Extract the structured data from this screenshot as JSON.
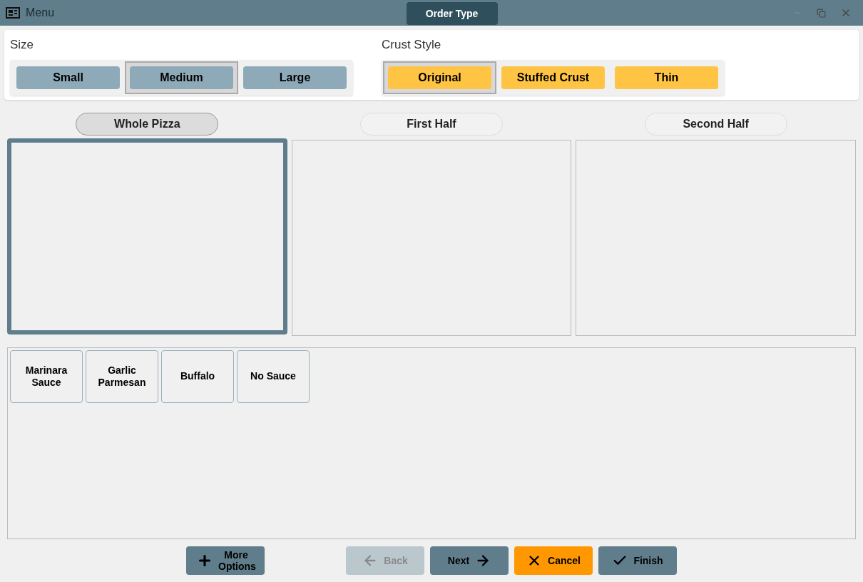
{
  "window": {
    "title": "Menu",
    "tab": "Order Type"
  },
  "size": {
    "label": "Size",
    "options": [
      {
        "label": "Small",
        "selected": false
      },
      {
        "label": "Medium",
        "selected": true
      },
      {
        "label": "Large",
        "selected": false
      }
    ]
  },
  "crust": {
    "label": "Crust Style",
    "options": [
      {
        "label": "Original",
        "selected": true
      },
      {
        "label": "Stuffed Crust",
        "selected": false
      },
      {
        "label": "Thin",
        "selected": false
      }
    ]
  },
  "portions": [
    {
      "label": "Whole Pizza",
      "selected": true
    },
    {
      "label": "First Half",
      "selected": false
    },
    {
      "label": "Second Half",
      "selected": false
    }
  ],
  "sauces": [
    "Marinara Sauce",
    "Garlic Parmesan",
    "Buffalo",
    "No Sauce"
  ],
  "footer": [
    {
      "kind": "plus",
      "label": "More Options",
      "disabled": false
    },
    {
      "kind": "back",
      "label": "Back",
      "disabled": true
    },
    {
      "kind": "next",
      "label": "Next",
      "disabled": false
    },
    {
      "kind": "cancel",
      "label": "Cancel",
      "disabled": false
    },
    {
      "kind": "finish",
      "label": "Finish",
      "disabled": false
    }
  ]
}
